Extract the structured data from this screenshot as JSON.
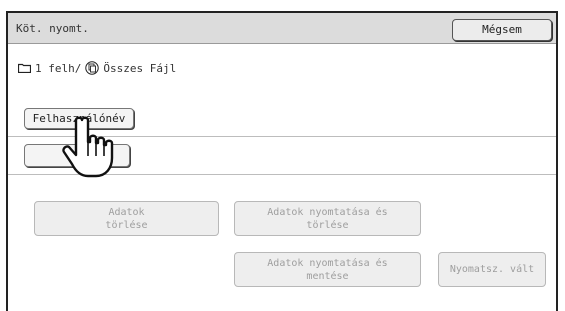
{
  "header": {
    "title": "Köt. nyomt.",
    "cancel_label": "Mégsem"
  },
  "breadcrumb": {
    "folder": "1 felh/",
    "all_files": "Összes Fájl"
  },
  "fields": {
    "username_label": "Felhasználónév",
    "second_label": ""
  },
  "actions": {
    "delete_data": {
      "line1": "Adatok",
      "line2": "törlése"
    },
    "print_delete": {
      "line1": "Adatok nyomtatása és",
      "line2": "törlése"
    },
    "print_save": {
      "line1": "Adatok nyomtatása és",
      "line2": "mentése"
    },
    "change_print_count": {
      "line1": "Nyomatsz. vált"
    }
  },
  "colors": {
    "titlebar": "#dcdcdc",
    "disabled_text": "#9e9e9e",
    "border": "#222222"
  },
  "icons": [
    "folder-icon",
    "all-files-icon",
    "pointing-hand-icon"
  ]
}
